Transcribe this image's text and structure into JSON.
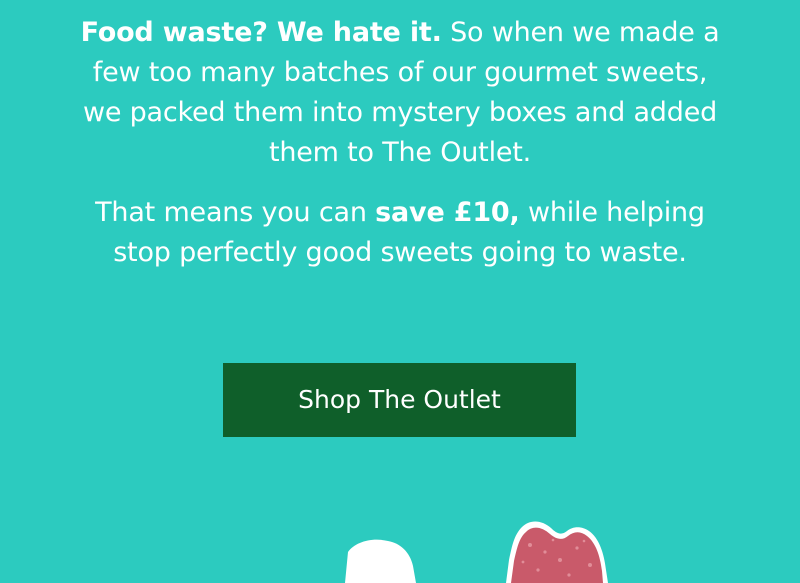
{
  "intro": {
    "bold_lead": "Food waste? We hate it.",
    "text": " So when we made a few too many batches of our gourmet sweets, we packed them into mystery boxes and added them to The Outlet."
  },
  "savings": {
    "before": "That means you can ",
    "bold": "save £10,",
    "after": " while helping stop perfectly good sweets going to waste."
  },
  "cta": {
    "label": "Shop The Outlet"
  },
  "colors": {
    "background": "#2ccbbf",
    "button": "#0f5f2a",
    "text": "#ffffff",
    "candy": "#c95a6a"
  }
}
